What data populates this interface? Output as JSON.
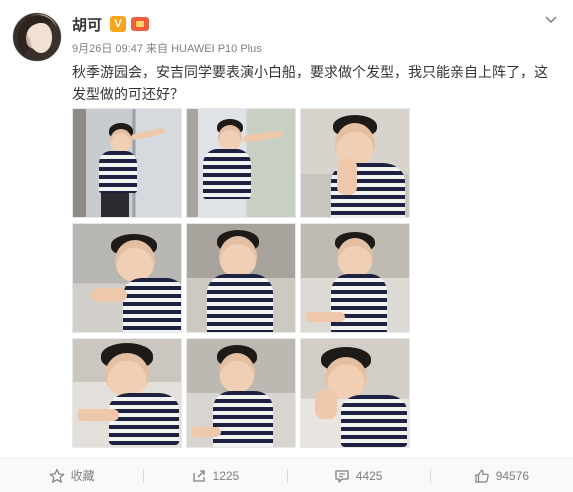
{
  "post": {
    "author": "胡可",
    "vip_badge": "V",
    "timestamp": "9月26日 09:47",
    "source_prefix": "来自",
    "source_device": "HUAWEI P10 Plus",
    "text": "秋季游园会，安吉同学要表演小白船，要求做个发型，我只能亲自上阵了，这发型做的可还好？",
    "photo_count": 9
  },
  "actions": {
    "favorite_label": "收藏",
    "repost_count": "1225",
    "comment_count": "4425",
    "like_count": "94576"
  },
  "colors": {
    "text": "#333333",
    "meta": "#808080",
    "vip_badge": "#f7a51c",
    "member_badge": "#f25d3a",
    "action_bar_bg": "#f9f9f9"
  },
  "icons": {
    "menu": "chevron-down-icon",
    "favorite": "star-icon",
    "repost": "repost-icon",
    "comment": "comment-icon",
    "like": "thumbs-up-icon"
  }
}
